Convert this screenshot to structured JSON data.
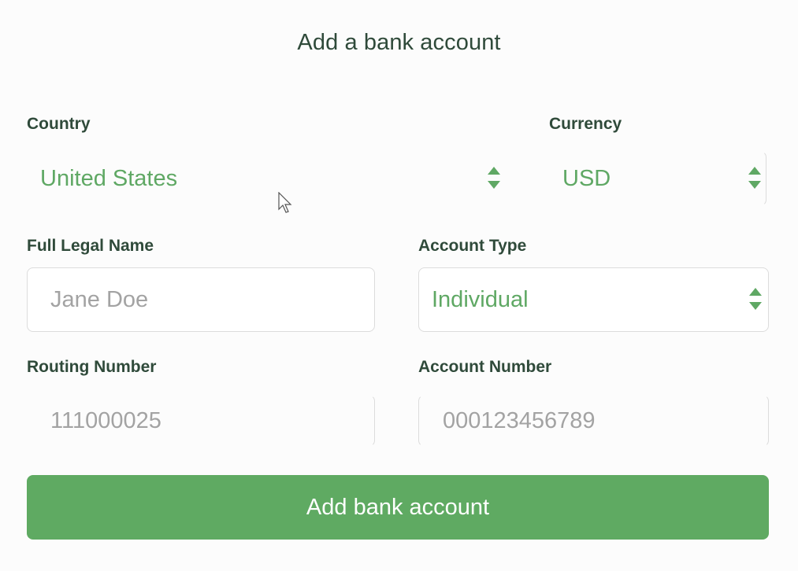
{
  "title": "Add a bank account",
  "country": {
    "label": "Country",
    "value": "United States"
  },
  "currency": {
    "label": "Currency",
    "value": "USD"
  },
  "full_legal_name": {
    "label": "Full Legal Name",
    "placeholder": "Jane Doe"
  },
  "account_type": {
    "label": "Account Type",
    "value": "Individual"
  },
  "routing_number": {
    "label": "Routing Number",
    "placeholder": "111000025"
  },
  "account_number": {
    "label": "Account Number",
    "placeholder": "000123456789"
  },
  "submit": {
    "label": "Add bank account"
  },
  "colors": {
    "accent": "#5faa62",
    "label_text": "#2f4a3a",
    "placeholder_text": "#a3a3a3"
  }
}
